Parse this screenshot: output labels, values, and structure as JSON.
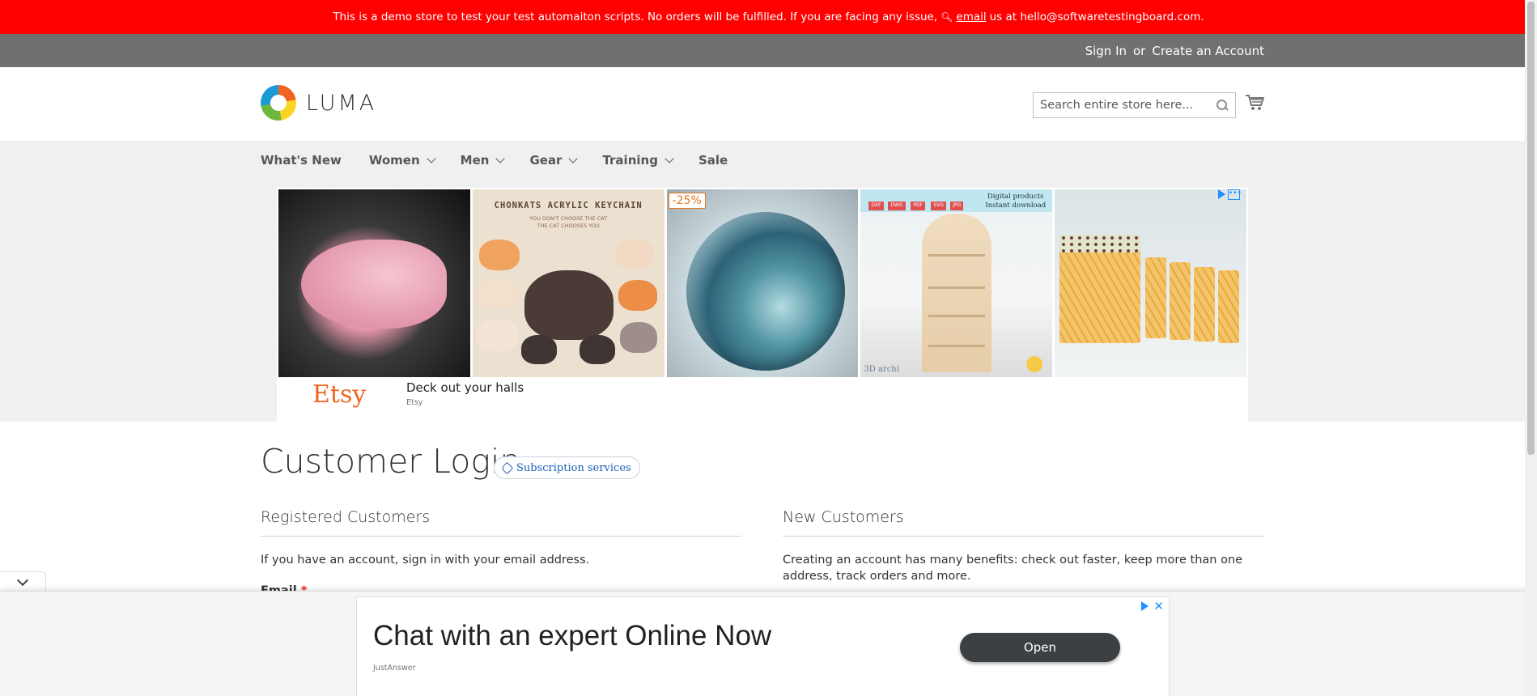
{
  "demo_notice": {
    "text_before": "This is a demo store to test your test automaiton scripts. No orders will be fulfilled. If you are facing any issue,",
    "link_text": "email",
    "text_after": "us at hello@softwaretestingboard.com."
  },
  "header": {
    "sign_in": "Sign In",
    "or": "or",
    "create_account": "Create an Account"
  },
  "logo": {
    "text": "LUMA"
  },
  "search": {
    "placeholder": "Search entire store here..."
  },
  "nav": {
    "items": [
      {
        "label": "What's New"
      },
      {
        "label": "Women"
      },
      {
        "label": "Men"
      },
      {
        "label": "Gear"
      },
      {
        "label": "Training"
      },
      {
        "label": "Sale"
      }
    ]
  },
  "ad_banner": {
    "tile2_title": "CHONKATS ACRYLIC KEYCHAIN",
    "tile2_sub1": "YOU DON'T CHOOSE THE CAT",
    "tile2_sub2": "THE CAT CHOOSES YOU",
    "discount_badge": "-25%",
    "formats": [
      "DXF",
      "DWG",
      "PDF",
      "SVG",
      "JPG"
    ],
    "digital_line1": "Digital products",
    "digital_line2": "Instant download",
    "tile4_brand": "3D archi",
    "advertiser_logo": "Etsy",
    "headline": "Deck out your halls",
    "advertiser": "Etsy"
  },
  "page": {
    "title": "Customer Login",
    "subscription_chip": "Subscription services"
  },
  "registered": {
    "title": "Registered Customers",
    "text": "If you have an account, sign in with your email address.",
    "email_label": "Email",
    "required_mark": "*"
  },
  "new_customers": {
    "title": "New Customers",
    "text": "Creating an account has many benefits: check out faster, keep more than one address, track orders and more."
  },
  "anchor_ad": {
    "headline": "Chat with an expert Online Now",
    "advertiser": "JustAnswer",
    "button": "Open"
  },
  "colors": {
    "demo_bar": "#ff0000",
    "panel_header": "#6e716e",
    "nav_bg": "#f0f0f0",
    "etsy_orange": "#f1641e",
    "link_blue": "#1a5fb4"
  }
}
